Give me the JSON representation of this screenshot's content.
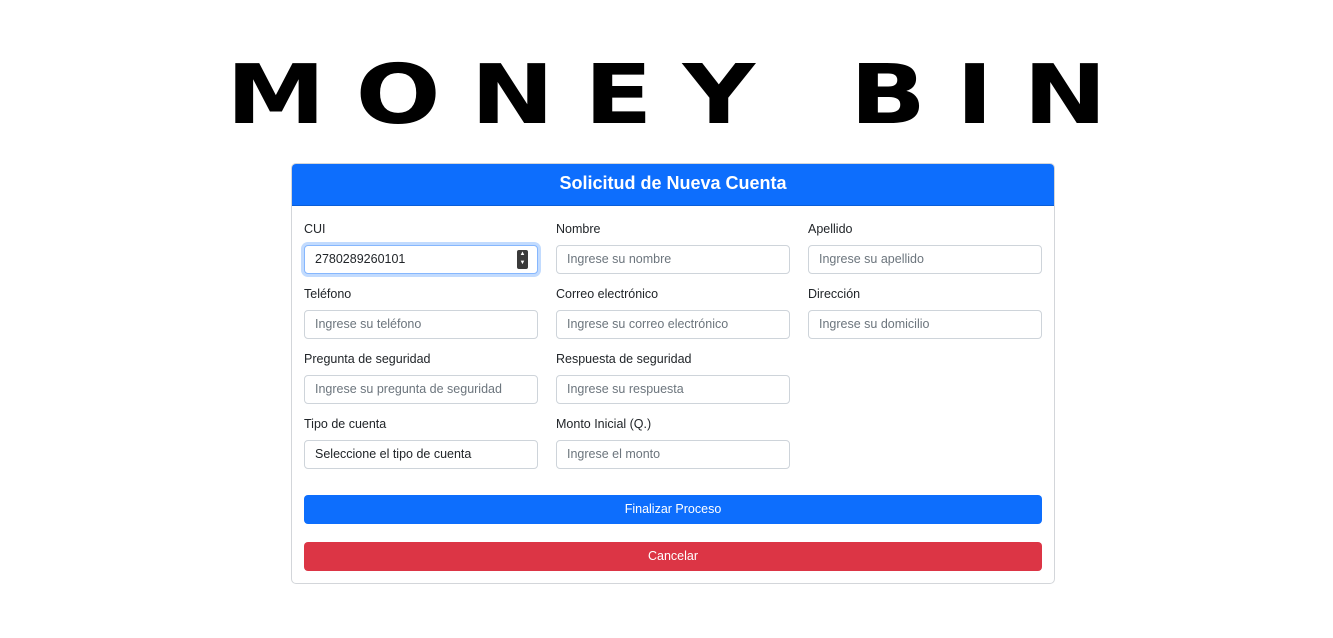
{
  "logo": {
    "text": "MONEY BIN"
  },
  "form": {
    "title": "Solicitud de Nueva Cuenta",
    "fields": {
      "cui": {
        "label": "CUI",
        "value": "2780289260101"
      },
      "nombre": {
        "label": "Nombre",
        "placeholder": "Ingrese su nombre"
      },
      "apellido": {
        "label": "Apellido",
        "placeholder": "Ingrese su apellido"
      },
      "telefono": {
        "label": "Teléfono",
        "placeholder": "Ingrese su teléfono"
      },
      "correo": {
        "label": "Correo electrónico",
        "placeholder": "Ingrese su correo electrónico"
      },
      "direccion": {
        "label": "Dirección",
        "placeholder": "Ingrese su domicilio"
      },
      "pregunta": {
        "label": "Pregunta de seguridad",
        "placeholder": "Ingrese su pregunta de seguridad"
      },
      "respuesta": {
        "label": "Respuesta de seguridad",
        "placeholder": "Ingrese su respuesta"
      },
      "tipo": {
        "label": "Tipo de cuenta",
        "value": "Seleccione el tipo de cuenta"
      },
      "monto": {
        "label": "Monto Inicial (Q.)",
        "placeholder": "Ingrese el monto"
      }
    },
    "buttons": {
      "finalizar": "Finalizar Proceso",
      "cancelar": "Cancelar"
    }
  },
  "colors": {
    "primary": "#0d6efd",
    "danger": "#dc3545"
  }
}
